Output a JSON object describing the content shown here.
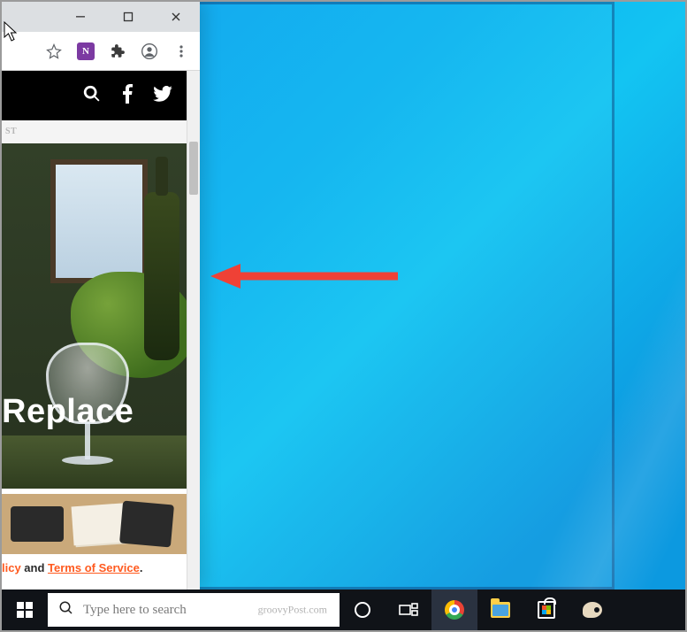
{
  "window_controls": {
    "minimize": "minimize",
    "maximize": "maximize",
    "close": "close"
  },
  "toolbar": {
    "star": "bookmark-star",
    "onenote": "onenote-clip",
    "extensions": "extensions",
    "profile": "profile",
    "menu": "menu"
  },
  "page": {
    "breadcrumb_tail": "ST",
    "headline_fragment": "Replace",
    "legal_prefix": "licy",
    "legal_and": " and ",
    "legal_tos": "Terms of Service",
    "legal_period": "."
  },
  "header_icons": {
    "search": "search",
    "facebook": "facebook",
    "twitter": "twitter"
  },
  "taskbar": {
    "search_placeholder": "Type here to search",
    "search_hint": "groovyPost.com"
  }
}
